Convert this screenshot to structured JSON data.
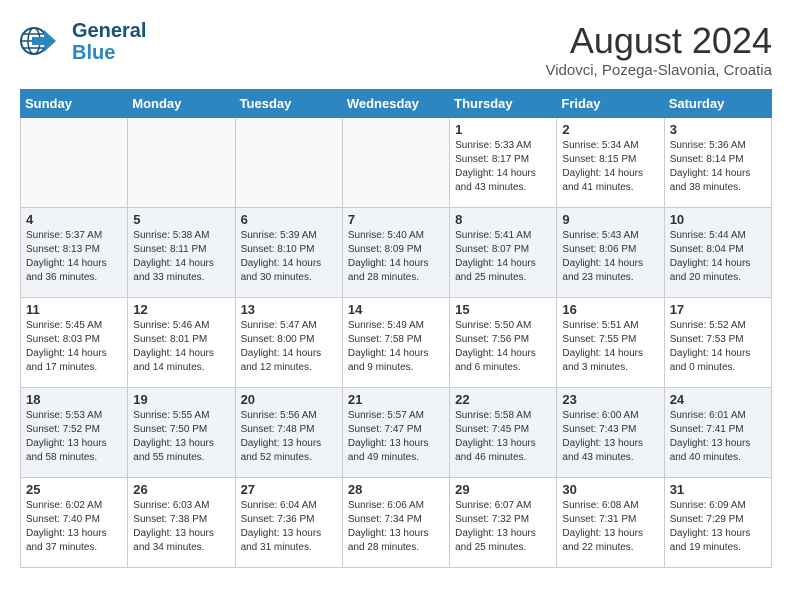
{
  "header": {
    "logo_line1": "General",
    "logo_line2": "Blue",
    "month": "August 2024",
    "location": "Vidovci, Pozega-Slavonia, Croatia"
  },
  "days_of_week": [
    "Sunday",
    "Monday",
    "Tuesday",
    "Wednesday",
    "Thursday",
    "Friday",
    "Saturday"
  ],
  "weeks": [
    [
      {
        "day": "",
        "content": ""
      },
      {
        "day": "",
        "content": ""
      },
      {
        "day": "",
        "content": ""
      },
      {
        "day": "",
        "content": ""
      },
      {
        "day": "1",
        "content": "Sunrise: 5:33 AM\nSunset: 8:17 PM\nDaylight: 14 hours\nand 43 minutes."
      },
      {
        "day": "2",
        "content": "Sunrise: 5:34 AM\nSunset: 8:15 PM\nDaylight: 14 hours\nand 41 minutes."
      },
      {
        "day": "3",
        "content": "Sunrise: 5:36 AM\nSunset: 8:14 PM\nDaylight: 14 hours\nand 38 minutes."
      }
    ],
    [
      {
        "day": "4",
        "content": "Sunrise: 5:37 AM\nSunset: 8:13 PM\nDaylight: 14 hours\nand 36 minutes."
      },
      {
        "day": "5",
        "content": "Sunrise: 5:38 AM\nSunset: 8:11 PM\nDaylight: 14 hours\nand 33 minutes."
      },
      {
        "day": "6",
        "content": "Sunrise: 5:39 AM\nSunset: 8:10 PM\nDaylight: 14 hours\nand 30 minutes."
      },
      {
        "day": "7",
        "content": "Sunrise: 5:40 AM\nSunset: 8:09 PM\nDaylight: 14 hours\nand 28 minutes."
      },
      {
        "day": "8",
        "content": "Sunrise: 5:41 AM\nSunset: 8:07 PM\nDaylight: 14 hours\nand 25 minutes."
      },
      {
        "day": "9",
        "content": "Sunrise: 5:43 AM\nSunset: 8:06 PM\nDaylight: 14 hours\nand 23 minutes."
      },
      {
        "day": "10",
        "content": "Sunrise: 5:44 AM\nSunset: 8:04 PM\nDaylight: 14 hours\nand 20 minutes."
      }
    ],
    [
      {
        "day": "11",
        "content": "Sunrise: 5:45 AM\nSunset: 8:03 PM\nDaylight: 14 hours\nand 17 minutes."
      },
      {
        "day": "12",
        "content": "Sunrise: 5:46 AM\nSunset: 8:01 PM\nDaylight: 14 hours\nand 14 minutes."
      },
      {
        "day": "13",
        "content": "Sunrise: 5:47 AM\nSunset: 8:00 PM\nDaylight: 14 hours\nand 12 minutes."
      },
      {
        "day": "14",
        "content": "Sunrise: 5:49 AM\nSunset: 7:58 PM\nDaylight: 14 hours\nand 9 minutes."
      },
      {
        "day": "15",
        "content": "Sunrise: 5:50 AM\nSunset: 7:56 PM\nDaylight: 14 hours\nand 6 minutes."
      },
      {
        "day": "16",
        "content": "Sunrise: 5:51 AM\nSunset: 7:55 PM\nDaylight: 14 hours\nand 3 minutes."
      },
      {
        "day": "17",
        "content": "Sunrise: 5:52 AM\nSunset: 7:53 PM\nDaylight: 14 hours\nand 0 minutes."
      }
    ],
    [
      {
        "day": "18",
        "content": "Sunrise: 5:53 AM\nSunset: 7:52 PM\nDaylight: 13 hours\nand 58 minutes."
      },
      {
        "day": "19",
        "content": "Sunrise: 5:55 AM\nSunset: 7:50 PM\nDaylight: 13 hours\nand 55 minutes."
      },
      {
        "day": "20",
        "content": "Sunrise: 5:56 AM\nSunset: 7:48 PM\nDaylight: 13 hours\nand 52 minutes."
      },
      {
        "day": "21",
        "content": "Sunrise: 5:57 AM\nSunset: 7:47 PM\nDaylight: 13 hours\nand 49 minutes."
      },
      {
        "day": "22",
        "content": "Sunrise: 5:58 AM\nSunset: 7:45 PM\nDaylight: 13 hours\nand 46 minutes."
      },
      {
        "day": "23",
        "content": "Sunrise: 6:00 AM\nSunset: 7:43 PM\nDaylight: 13 hours\nand 43 minutes."
      },
      {
        "day": "24",
        "content": "Sunrise: 6:01 AM\nSunset: 7:41 PM\nDaylight: 13 hours\nand 40 minutes."
      }
    ],
    [
      {
        "day": "25",
        "content": "Sunrise: 6:02 AM\nSunset: 7:40 PM\nDaylight: 13 hours\nand 37 minutes."
      },
      {
        "day": "26",
        "content": "Sunrise: 6:03 AM\nSunset: 7:38 PM\nDaylight: 13 hours\nand 34 minutes."
      },
      {
        "day": "27",
        "content": "Sunrise: 6:04 AM\nSunset: 7:36 PM\nDaylight: 13 hours\nand 31 minutes."
      },
      {
        "day": "28",
        "content": "Sunrise: 6:06 AM\nSunset: 7:34 PM\nDaylight: 13 hours\nand 28 minutes."
      },
      {
        "day": "29",
        "content": "Sunrise: 6:07 AM\nSunset: 7:32 PM\nDaylight: 13 hours\nand 25 minutes."
      },
      {
        "day": "30",
        "content": "Sunrise: 6:08 AM\nSunset: 7:31 PM\nDaylight: 13 hours\nand 22 minutes."
      },
      {
        "day": "31",
        "content": "Sunrise: 6:09 AM\nSunset: 7:29 PM\nDaylight: 13 hours\nand 19 minutes."
      }
    ]
  ]
}
